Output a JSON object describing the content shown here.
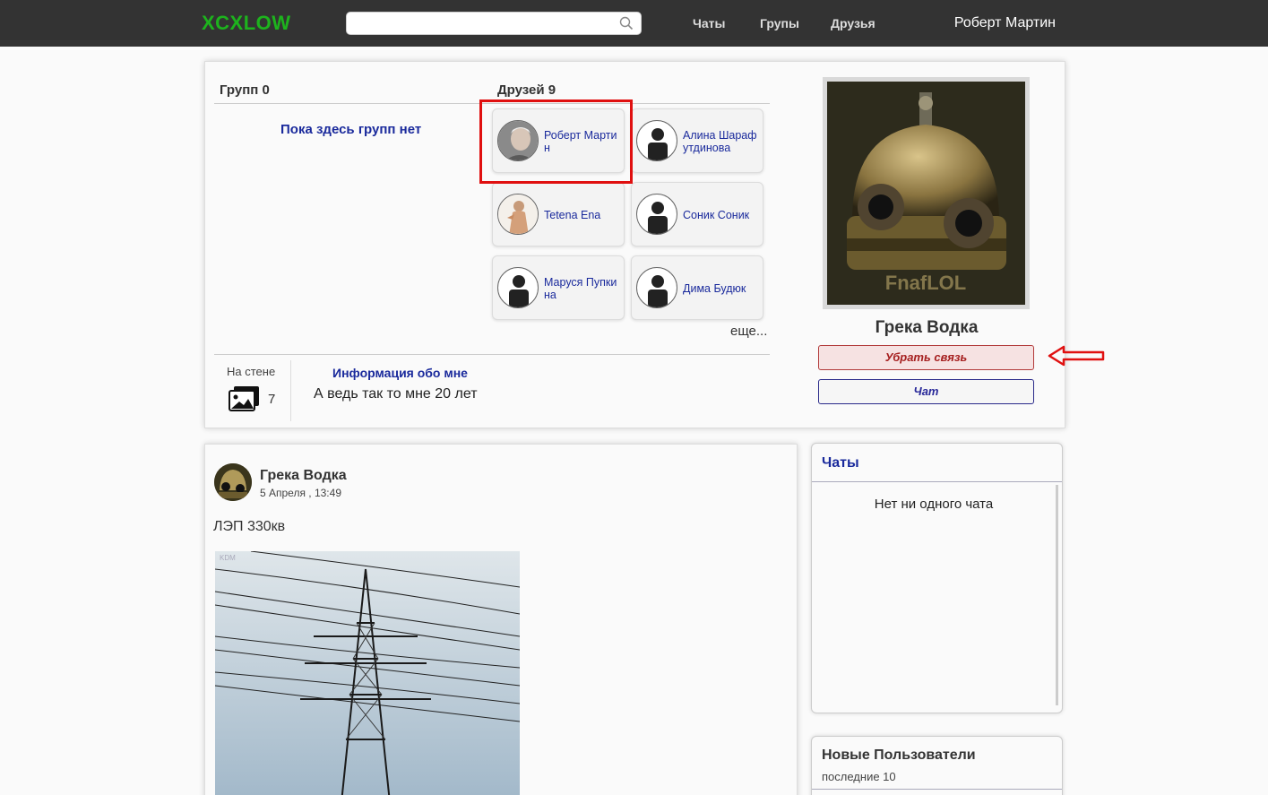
{
  "header": {
    "logo": "XCXLOW",
    "search_placeholder": "",
    "nav": [
      "Чаты",
      "Групы",
      "Друзья"
    ],
    "user_name": "Роберт Мартин"
  },
  "profile": {
    "groups_title": "Групп 0",
    "no_groups_text": "Пока здесь групп нет",
    "friends_title": "Друзей 9",
    "friends": [
      {
        "name": "Роберт Мартин",
        "avatar": "photo-elderly-man"
      },
      {
        "name": "Алина Шарафутдинова",
        "avatar": "default-user-icon"
      },
      {
        "name": "Tetena Ena",
        "avatar": "photo-figure"
      },
      {
        "name": "Соник Соник",
        "avatar": "default-user-icon"
      },
      {
        "name": "Маруся Пупкина",
        "avatar": "default-user-icon"
      },
      {
        "name": "Дима Будюк",
        "avatar": "default-user-icon"
      }
    ],
    "more_link": "еще...",
    "wall_label": "На стене",
    "wall_count": "7",
    "info_title": "Информация обо мне",
    "info_text": "А ведь так то мне 20 лет",
    "name": "Грека Водка",
    "remove_button": "Убрать связь",
    "chat_button": "Чат",
    "photo_watermark": "FnafLOL"
  },
  "post": {
    "author": "Грека Водка",
    "date": "5 Апреля , 13:49",
    "text": "ЛЭП 330кв",
    "image_watermark": "KDM"
  },
  "chats": {
    "title": "Чаты",
    "empty_text": "Нет ни одного чата"
  },
  "new_users": {
    "title": "Новые Пользователи",
    "subtitle": "последние 10"
  },
  "colors": {
    "topbar": "#333333",
    "logo": "#1db31d",
    "link": "#1a2a9c",
    "annotation": "#e01010"
  }
}
